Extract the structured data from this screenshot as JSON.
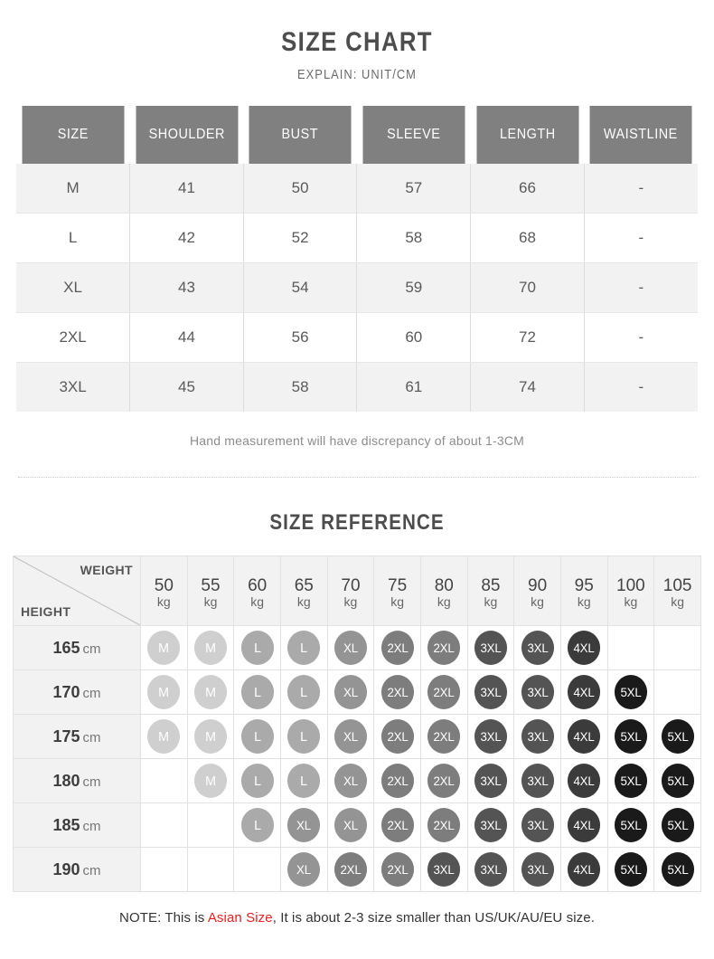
{
  "section1": {
    "title": "SIZE CHART",
    "subtitle": "EXPLAIN: UNIT/CM",
    "note": "Hand measurement will have discrepancy of about 1-3CM"
  },
  "section2": {
    "title": "SIZE REFERENCE",
    "corner": {
      "weight_label": "WEIGHT",
      "height_label": "HEIGHT"
    },
    "footer_prefix": "NOTE: This is ",
    "footer_highlight": "Asian Size",
    "footer_suffix": ", It is about 2-3 size smaller than US/UK/AU/EU size."
  },
  "colors": {
    "header_bg": "#808080",
    "row_alt_bg": "#f2f2f2",
    "accent_red": "#e8201f",
    "bubble_M": "#cfcfcf",
    "bubble_L": "#aaaaaa",
    "bubble_XL": "#949494",
    "bubble_2XL": "#7d7d7d",
    "bubble_3XL": "#545454",
    "bubble_4XL": "#3b3b3b",
    "bubble_5XL": "#1a1a1a"
  },
  "chart_data": [
    {
      "type": "table",
      "title": "SIZE CHART",
      "subtitle": "EXPLAIN: UNIT/CM",
      "columns": [
        "SIZE",
        "SHOULDER",
        "BUST",
        "SLEEVE",
        "LENGTH",
        "WAISTLINE"
      ],
      "rows": [
        [
          "M",
          "41",
          "50",
          "57",
          "66",
          "-"
        ],
        [
          "L",
          "42",
          "52",
          "58",
          "68",
          "-"
        ],
        [
          "XL",
          "43",
          "54",
          "59",
          "70",
          "-"
        ],
        [
          "2XL",
          "44",
          "56",
          "60",
          "72",
          "-"
        ],
        [
          "3XL",
          "45",
          "58",
          "61",
          "74",
          "-"
        ]
      ],
      "note": "Hand measurement will have discrepancy of about 1-3CM"
    },
    {
      "type": "heatmap",
      "title": "SIZE REFERENCE",
      "xlabel": "WEIGHT",
      "ylabel": "HEIGHT",
      "x_categories": [
        "50",
        "55",
        "60",
        "65",
        "70",
        "75",
        "80",
        "85",
        "90",
        "95",
        "100",
        "105"
      ],
      "x_unit": "kg",
      "y_categories": [
        "165",
        "170",
        "175",
        "180",
        "185",
        "190"
      ],
      "y_unit": "cm",
      "legend": [
        "M",
        "L",
        "XL",
        "2XL",
        "3XL",
        "4XL",
        "5XL"
      ],
      "values": [
        [
          "M",
          "M",
          "L",
          "L",
          "XL",
          "2XL",
          "2XL",
          "3XL",
          "3XL",
          "4XL",
          "",
          ""
        ],
        [
          "M",
          "M",
          "L",
          "L",
          "XL",
          "2XL",
          "2XL",
          "3XL",
          "3XL",
          "4XL",
          "5XL",
          ""
        ],
        [
          "M",
          "M",
          "L",
          "L",
          "XL",
          "2XL",
          "2XL",
          "3XL",
          "3XL",
          "4XL",
          "5XL",
          "5XL"
        ],
        [
          "",
          "M",
          "L",
          "L",
          "XL",
          "2XL",
          "2XL",
          "3XL",
          "3XL",
          "4XL",
          "5XL",
          "5XL"
        ],
        [
          "",
          "",
          "L",
          "XL",
          "XL",
          "2XL",
          "2XL",
          "3XL",
          "3XL",
          "4XL",
          "5XL",
          "5XL"
        ],
        [
          "",
          "",
          "",
          "XL",
          "2XL",
          "2XL",
          "3XL",
          "3XL",
          "3XL",
          "4XL",
          "5XL",
          "5XL"
        ]
      ]
    }
  ]
}
